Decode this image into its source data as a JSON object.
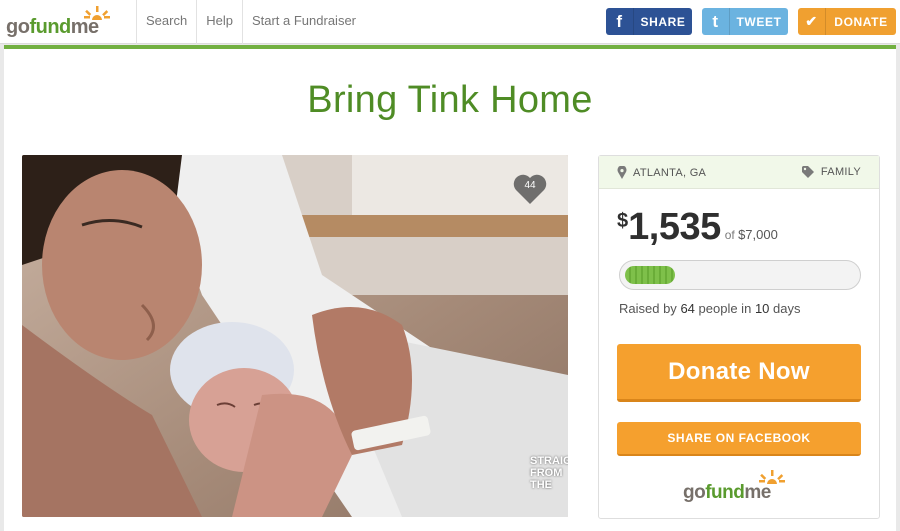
{
  "nav": {
    "logo": {
      "go": "go",
      "fund": "fund",
      "me": "me"
    },
    "links": [
      "Search",
      "Help",
      "Start a Fundraiser"
    ],
    "share_fb": {
      "icon": "f",
      "label": "SHARE"
    },
    "tweet": {
      "icon": "t",
      "label": "TWEET"
    },
    "donate": {
      "icon": "✔",
      "label": "DONATE"
    }
  },
  "campaign": {
    "title": "Bring Tink Home",
    "hearts": "44",
    "watermark": [
      "STRAIGHT",
      "FROM",
      "THE"
    ]
  },
  "sidebar": {
    "location": "ATLANTA, GA",
    "category": "FAMILY",
    "currency": "$",
    "raised": "1,535",
    "goal_prefix": "of",
    "goal": "$7,000",
    "progress_fraction": 0.219,
    "raised_by": {
      "prefix": "Raised by",
      "people": "64",
      "mid": "people in",
      "days": "10",
      "suffix": "days"
    },
    "donate_now": "Donate Now",
    "share_facebook": "SHARE ON FACEBOOK"
  },
  "colors": {
    "brand_green": "#4f8c25",
    "accent_orange": "#f5a02e",
    "facebook_blue": "#2d5295",
    "twitter_blue": "#6bb3e0"
  }
}
